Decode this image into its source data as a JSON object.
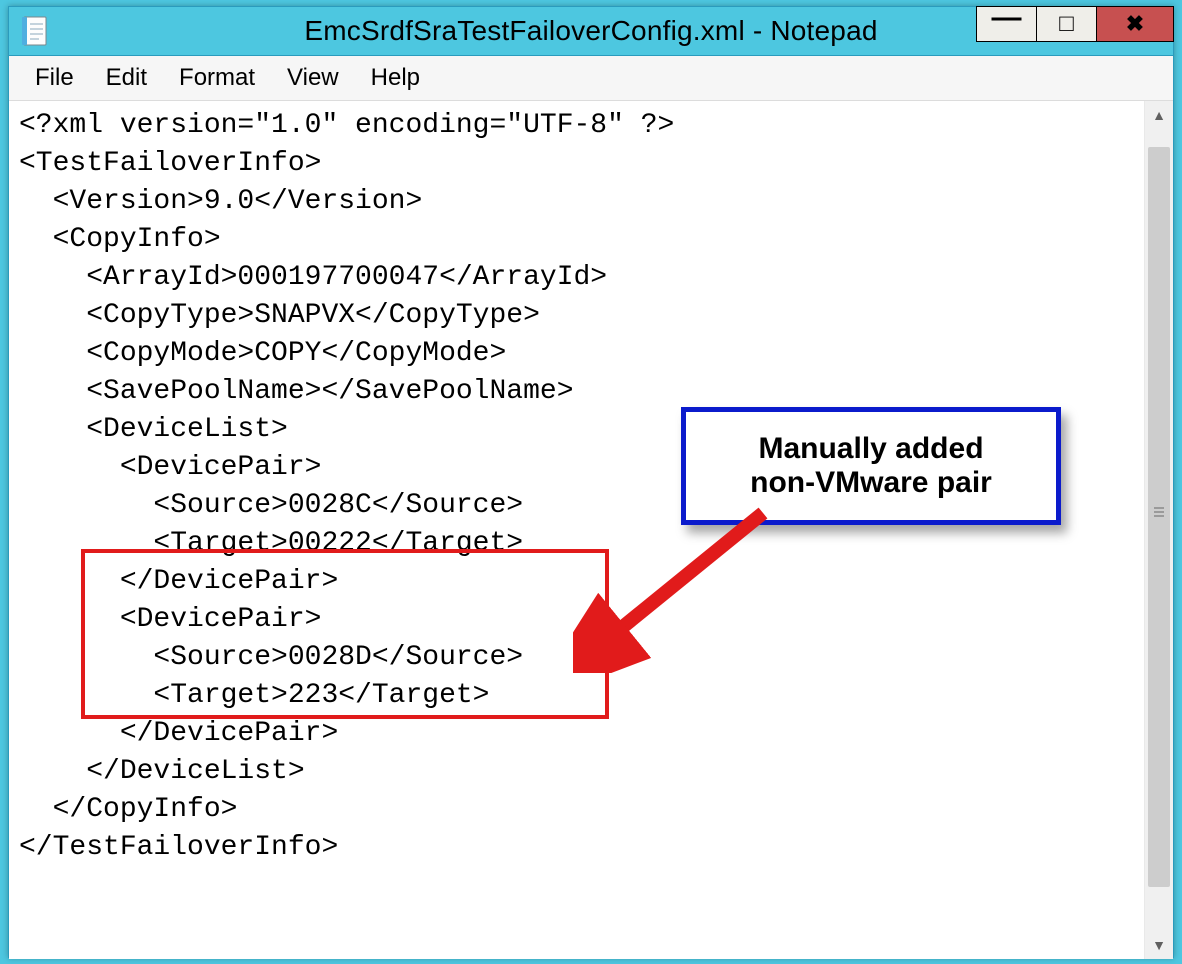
{
  "title": "EmcSrdfSraTestFailoverConfig.xml - Notepad",
  "menu": {
    "file": "File",
    "edit": "Edit",
    "format": "Format",
    "view": "View",
    "help": "Help"
  },
  "doc_lines": [
    "<?xml version=\"1.0\" encoding=\"UTF-8\" ?>",
    "<TestFailoverInfo>",
    "  <Version>9.0</Version>",
    "  <CopyInfo>",
    "    <ArrayId>000197700047</ArrayId>",
    "    <CopyType>SNAPVX</CopyType>",
    "    <CopyMode>COPY</CopyMode>",
    "    <SavePoolName></SavePoolName>",
    "    <DeviceList>",
    "      <DevicePair>",
    "        <Source>0028C</Source>",
    "        <Target>00222</Target>",
    "      </DevicePair>",
    "      <DevicePair>",
    "        <Source>0028D</Source>",
    "        <Target>223</Target>",
    "      </DevicePair>",
    "    </DeviceList>",
    "  </CopyInfo>",
    "</TestFailoverInfo>"
  ],
  "callout": {
    "line1": "Manually added",
    "line2": "non-VMware pair"
  },
  "window_buttons": {
    "min": "—",
    "max": "◻",
    "close": "✕"
  },
  "scroll": {
    "up": "ʌ",
    "down": "˅"
  }
}
